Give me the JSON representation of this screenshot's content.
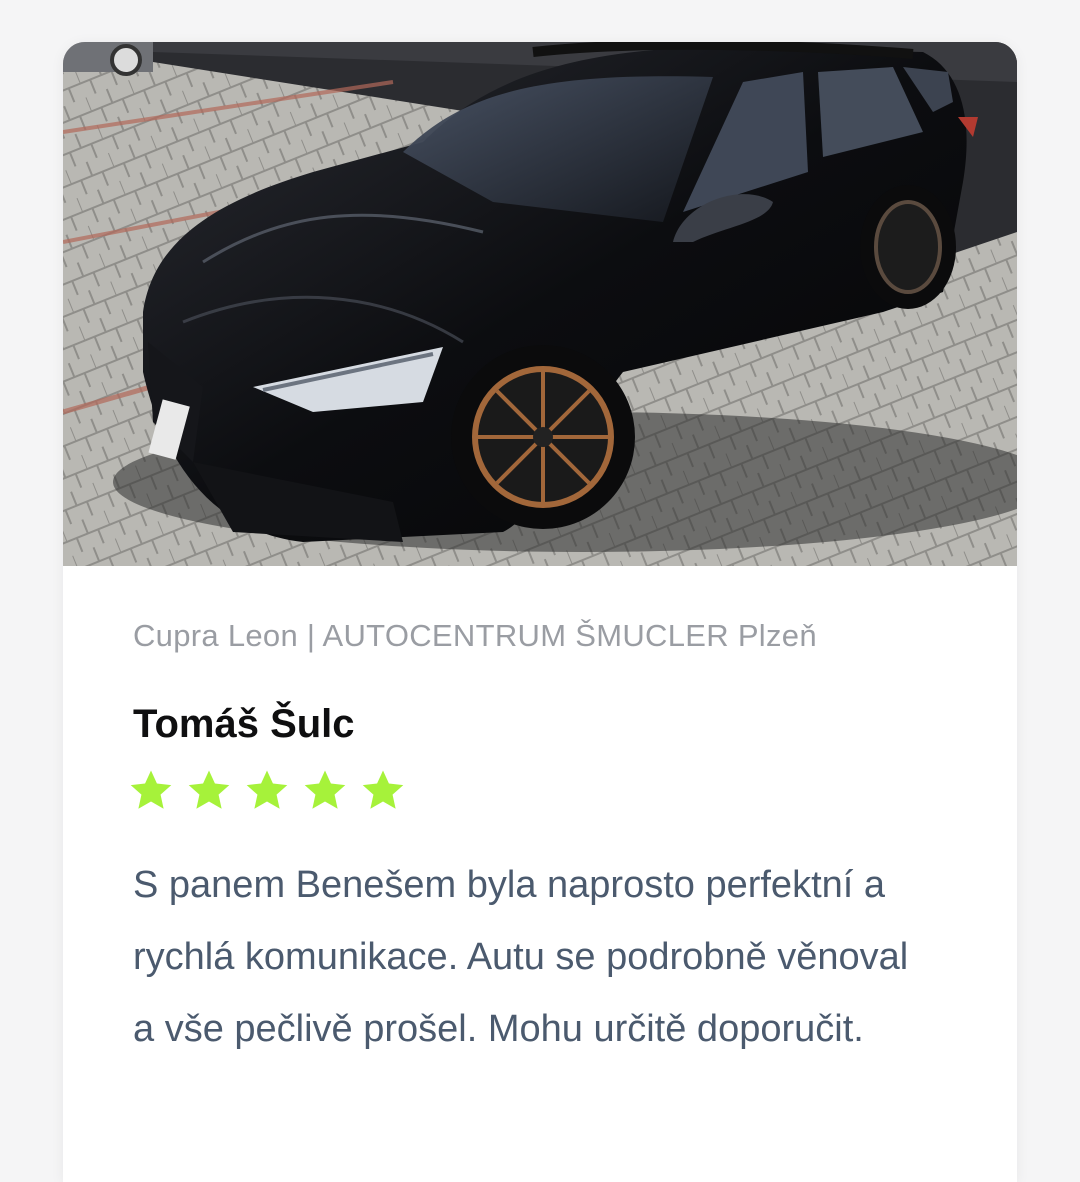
{
  "card": {
    "image": {
      "subject": "black-station-wagon-photo"
    },
    "meta": "Cupra Leon | AUTOCENTRUM ŠMUCLER Plzeň",
    "reviewer_name": "Tomáš Šulc",
    "rating": {
      "value": 5,
      "max": 5,
      "star_color": "#a6f23a"
    },
    "review_text": "S panem Benešem byla naprosto perfektní a rychlá komunikace. Autu se podrobně věnoval a vše pečlivě prošel. Mohu určitě doporučit."
  }
}
